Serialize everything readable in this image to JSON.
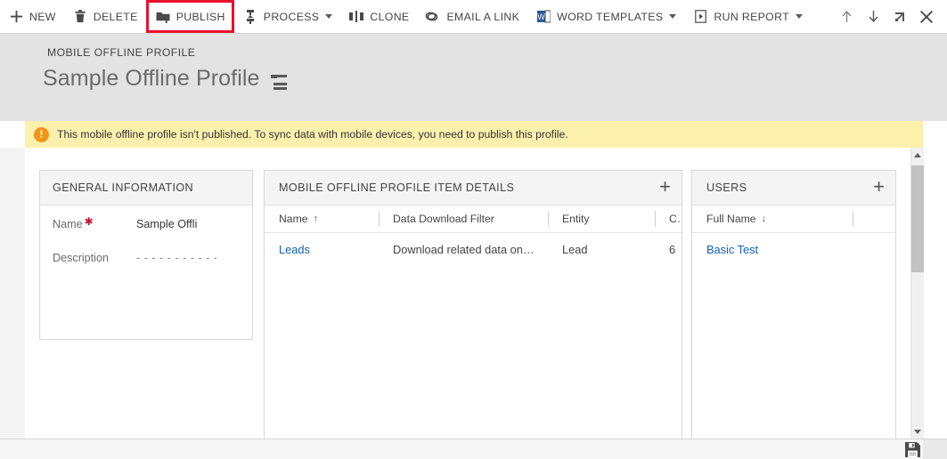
{
  "command_bar": {
    "items": [
      {
        "id": "new",
        "label": "NEW",
        "icon": "plus-icon",
        "dropdown": false,
        "highlighted": false
      },
      {
        "id": "delete",
        "label": "DELETE",
        "icon": "trash-icon",
        "dropdown": false,
        "highlighted": false
      },
      {
        "id": "publish",
        "label": "PUBLISH",
        "icon": "publish-icon",
        "dropdown": false,
        "highlighted": true
      },
      {
        "id": "process",
        "label": "PROCESS",
        "icon": "process-icon",
        "dropdown": true,
        "highlighted": false
      },
      {
        "id": "clone",
        "label": "CLONE",
        "icon": "clone-icon",
        "dropdown": false,
        "highlighted": false
      },
      {
        "id": "email-a-link",
        "label": "EMAIL A LINK",
        "icon": "link-icon",
        "dropdown": false,
        "highlighted": false
      },
      {
        "id": "word-templates",
        "label": "WORD TEMPLATES",
        "icon": "word-document-icon",
        "dropdown": true,
        "highlighted": false
      },
      {
        "id": "run-report",
        "label": "RUN REPORT",
        "icon": "report-play-icon",
        "dropdown": true,
        "highlighted": false
      }
    ],
    "window_icons": [
      {
        "id": "previous-record",
        "icon": "arrow-up-icon"
      },
      {
        "id": "next-record",
        "icon": "arrow-down-icon"
      },
      {
        "id": "pop-out",
        "icon": "pop-out-icon"
      },
      {
        "id": "close",
        "icon": "close-icon"
      }
    ],
    "highlight_color": "#e8112d"
  },
  "header": {
    "entity_name": "MOBILE OFFLINE PROFILE",
    "record_title": "Sample Offline Profile",
    "record_menu_icon": "record-set-menu-icon",
    "background_color": "#e3e3e3"
  },
  "notification": {
    "icon": "warning-icon",
    "icon_color": "#f29415",
    "background_color": "#fcf0ad",
    "message": "This mobile offline profile isn't published. To sync data with mobile devices, you need to publish this profile."
  },
  "general_information": {
    "title": "GENERAL INFORMATION",
    "fields": [
      {
        "label": "Name",
        "required": true,
        "value": "Sample Offli"
      },
      {
        "label": "Description",
        "required": false,
        "value": "- - - - - - - - - - - - - - -"
      }
    ]
  },
  "item_details": {
    "title": "MOBILE OFFLINE PROFILE ITEM DETAILS",
    "add_icon": "plus-icon",
    "columns": [
      {
        "label": "Name",
        "sort": "↑"
      },
      {
        "label": "Data Download Filter",
        "sort": ""
      },
      {
        "label": "Entity",
        "sort": ""
      },
      {
        "label": "C…",
        "sort": ""
      }
    ],
    "rows": [
      {
        "name": "Leads",
        "data_download_filter": "Download related data on…",
        "entity": "Lead",
        "created": "6"
      }
    ]
  },
  "users": {
    "title": "USERS",
    "add_icon": "plus-icon",
    "columns": [
      {
        "label": "Full Name",
        "sort": "↓"
      },
      {
        "label": "",
        "sort": ""
      }
    ],
    "rows": [
      {
        "full_name": "Basic Test"
      }
    ]
  },
  "scrollbar": {
    "up_icon": "triangle-up-icon",
    "down_icon": "triangle-down-icon"
  },
  "footer": {
    "save_icon": "save-floppy-icon"
  }
}
